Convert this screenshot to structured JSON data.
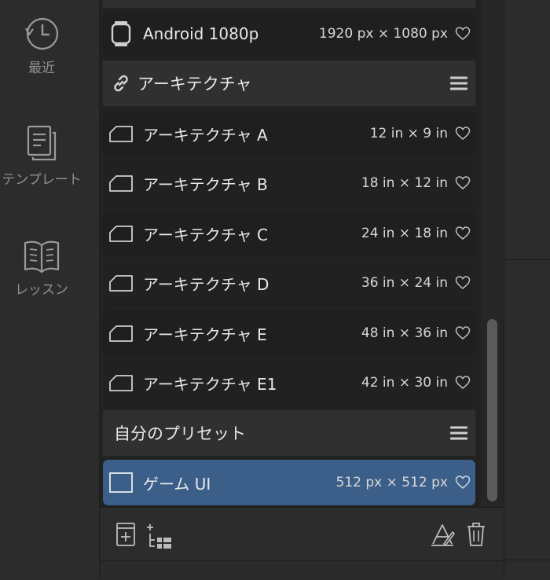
{
  "nav": {
    "recent_label": "最近",
    "templates_label": "テンプレート",
    "lessons_label": "レッスン"
  },
  "presets": {
    "android": {
      "name": "Android 1080p",
      "size": "1920 px × 1080 px"
    },
    "arch_group": {
      "title": "アーキテクチャ"
    },
    "arch_items": [
      {
        "name": "アーキテクチャ A",
        "size": "12 in × 9 in"
      },
      {
        "name": "アーキテクチャ B",
        "size": "18 in × 12 in"
      },
      {
        "name": "アーキテクチャ C",
        "size": "24 in × 18 in"
      },
      {
        "name": "アーキテクチャ D",
        "size": "36 in × 24 in"
      },
      {
        "name": "アーキテクチャ E",
        "size": "48 in × 36 in"
      },
      {
        "name": "アーキテクチャ E1",
        "size": "42 in × 30 in"
      }
    ],
    "my_group": {
      "title": "自分のプリセット"
    },
    "my_items": [
      {
        "name": "ゲーム UI",
        "size": "512 px × 512 px",
        "selected": true
      }
    ]
  },
  "colors": {
    "selected_row": "#3c5f8a",
    "group_header": "#303030"
  }
}
